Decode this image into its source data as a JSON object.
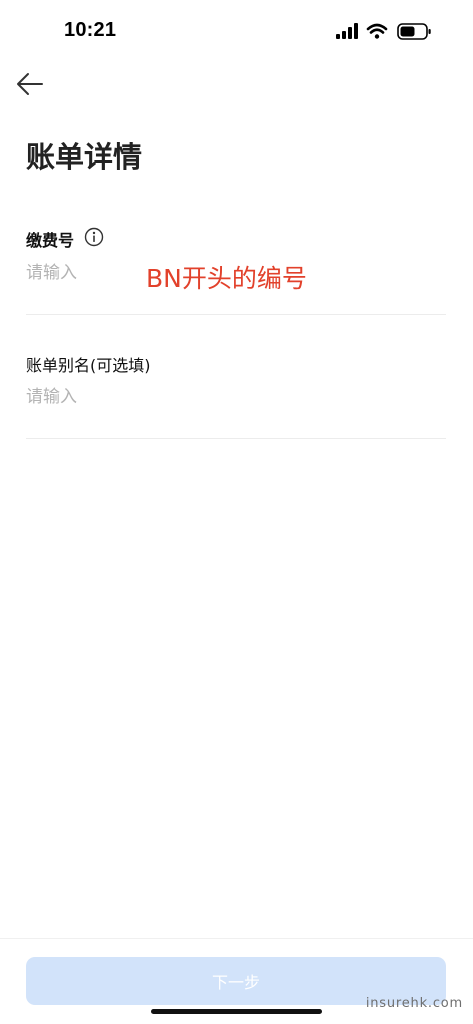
{
  "status_bar": {
    "time": "10:21"
  },
  "header": {
    "back_icon": "arrow-left-icon",
    "title": "账单详情"
  },
  "form": {
    "payment_number": {
      "label": "缴费号",
      "info_icon": "info-circle-icon",
      "placeholder": "请输入",
      "value": ""
    },
    "bill_alias": {
      "label": "账单别名(可选填)",
      "placeholder": "请输入",
      "value": ""
    }
  },
  "annotation": {
    "text": "BN开头的编号",
    "color": "#e2412b"
  },
  "footer": {
    "next_label": "下一步",
    "button_color": "#d2e3fa"
  },
  "watermark": "insurehk.com"
}
